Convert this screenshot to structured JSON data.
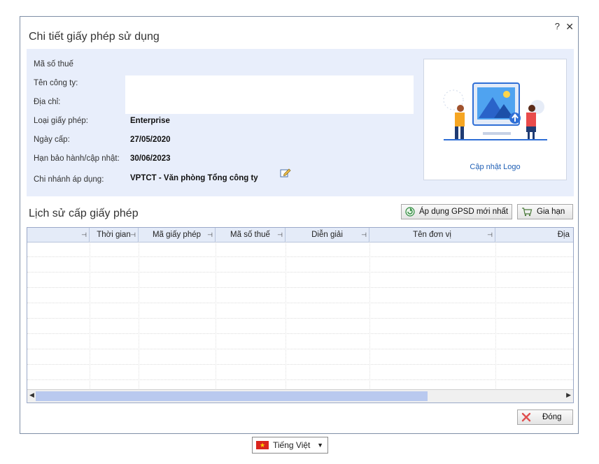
{
  "dialog": {
    "title": "Chi tiết giấy phép sử dụng",
    "help": "?",
    "close": "✕"
  },
  "info": {
    "tax_code_label": "Mã số thuế",
    "company_label": "Tên công ty:",
    "address_label": "Địa chỉ:",
    "license_type_label": "Loại giấy phép:",
    "license_type_value": "Enterprise",
    "issue_date_label": "Ngày cấp:",
    "issue_date_value": "27/05/2020",
    "warranty_label": "Hạn bảo hành/cập nhật:",
    "warranty_value": "30/06/2023",
    "branch_label": "Chi nhánh áp dụng:",
    "branch_value": "VPTCT - Văn phòng Tổng công ty",
    "update_logo": "Cập nhật Logo"
  },
  "history": {
    "title": "Lịch sử cấp giấy phép",
    "apply_button": "Áp dụng GPSD mới nhất",
    "extend_button": "Gia hạn",
    "columns": [
      "",
      "Thời gian",
      "Mã giấy phép",
      "Mã số thuế",
      "Diễn giải",
      "Tên đơn vị",
      "Địa"
    ]
  },
  "footer": {
    "close_button": "Đóng",
    "language": "Tiếng Việt"
  },
  "colors": {
    "accent": "#1f5fb5",
    "info_bg": "#e8eefb",
    "grid_header": "#e4ebf8"
  }
}
